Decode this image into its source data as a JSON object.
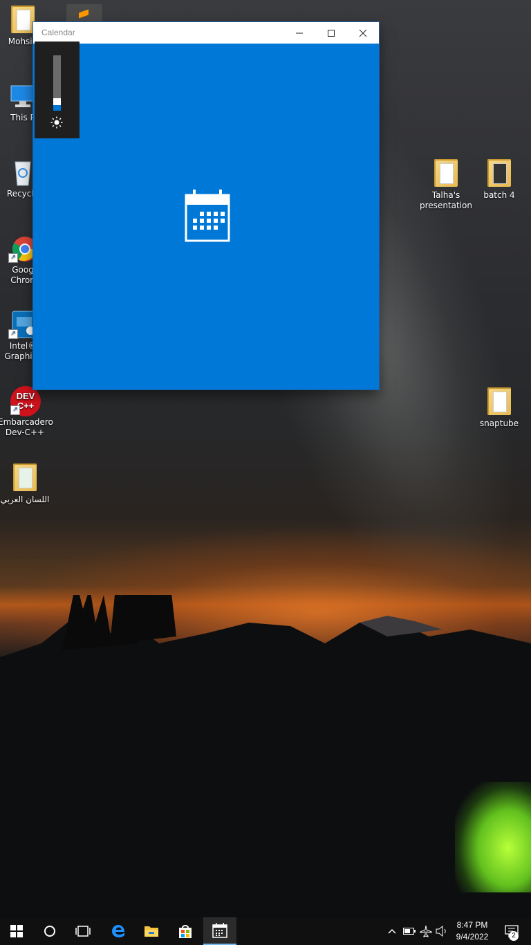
{
  "window": {
    "title": "Calendar"
  },
  "brightness": {
    "level_percent": 10
  },
  "desktop_icons": {
    "mohsin": "Mohsin",
    "this_pc": "This P",
    "recycle": "Recycle",
    "chrome_line1": "Goog",
    "chrome_line2": "Chron",
    "intel_line1": "Intel®",
    "intel_line2": "Graphics",
    "devcpp_line1": "Embarcadero",
    "devcpp_line2": "Dev-C++",
    "devcpp_badge": "DEV C++",
    "arabic": "اللسان العربي",
    "talha_line1": "Talha's",
    "talha_line2": "presentation",
    "batch4": "batch 4",
    "snaptube": "snaptube"
  },
  "taskbar": {
    "time": "8:47 PM",
    "date": "9/4/2022",
    "notification_count": "2"
  },
  "colors": {
    "accent": "#0078d7",
    "taskbar": "#101010",
    "active_underline": "#76b9ed"
  }
}
